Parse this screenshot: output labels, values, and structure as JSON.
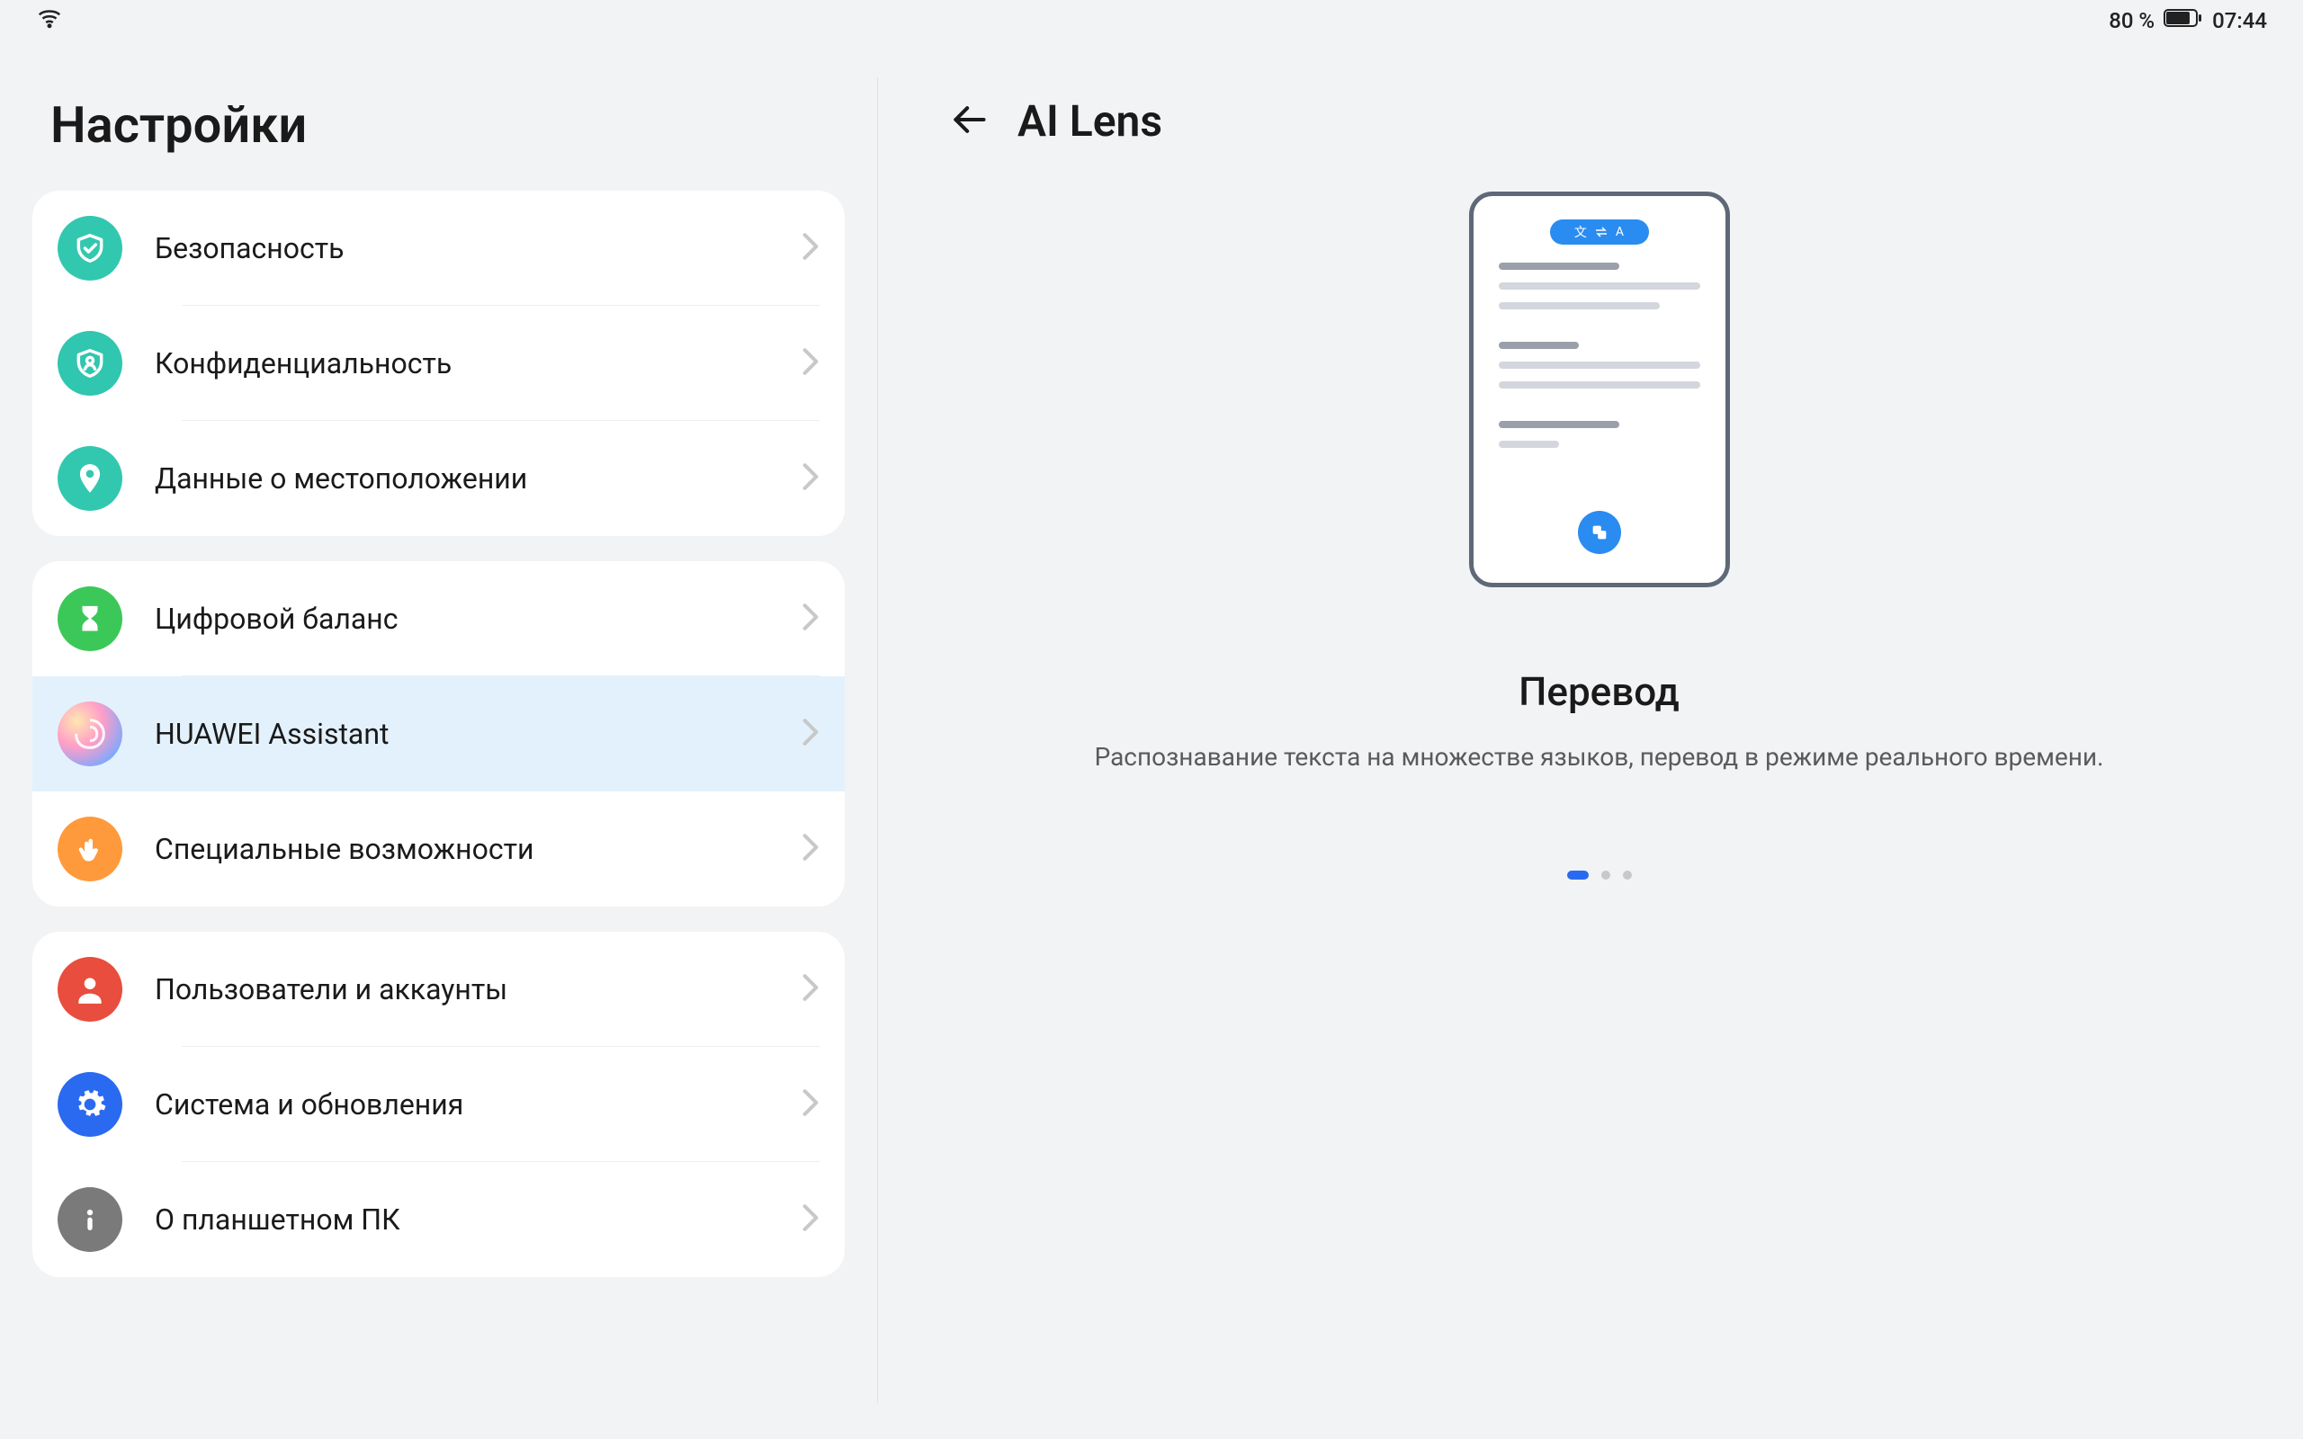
{
  "status": {
    "battery_text": "80 %",
    "time": "07:44"
  },
  "settings": {
    "title": "Настройки",
    "groups": [
      {
        "items": [
          {
            "id": "security",
            "icon": "shield-check",
            "bg": "bg-teal",
            "label": "Безопасность"
          },
          {
            "id": "privacy",
            "icon": "privacy",
            "bg": "bg-teal2",
            "label": "Конфиденциальность"
          },
          {
            "id": "location",
            "icon": "location",
            "bg": "bg-teal",
            "label": "Данные о местоположении"
          }
        ]
      },
      {
        "items": [
          {
            "id": "digital-balance",
            "icon": "hourglass",
            "bg": "bg-green",
            "label": "Цифровой баланс"
          },
          {
            "id": "huawei-assistant",
            "icon": "swirl",
            "bg": "bg-gradient",
            "label": "HUAWEI Assistant",
            "selected": true
          },
          {
            "id": "accessibility",
            "icon": "touch",
            "bg": "bg-orange",
            "label": "Специальные возможности"
          }
        ]
      },
      {
        "items": [
          {
            "id": "users-accounts",
            "icon": "person",
            "bg": "bg-red",
            "label": "Пользователи и аккаунты"
          },
          {
            "id": "system-updates",
            "icon": "gear",
            "bg": "bg-blue",
            "label": "Система и обновления"
          },
          {
            "id": "about-tablet",
            "icon": "info",
            "bg": "bg-gray",
            "label": "О планшетном ПК"
          }
        ]
      }
    ]
  },
  "detail": {
    "title": "AI Lens",
    "carousel": {
      "heading": "Перевод",
      "description": "Распознавание текста на множестве языков, перевод в режиме реального времени.",
      "active_index": 0,
      "total": 3,
      "pill_left": "文",
      "pill_right": "A"
    }
  }
}
